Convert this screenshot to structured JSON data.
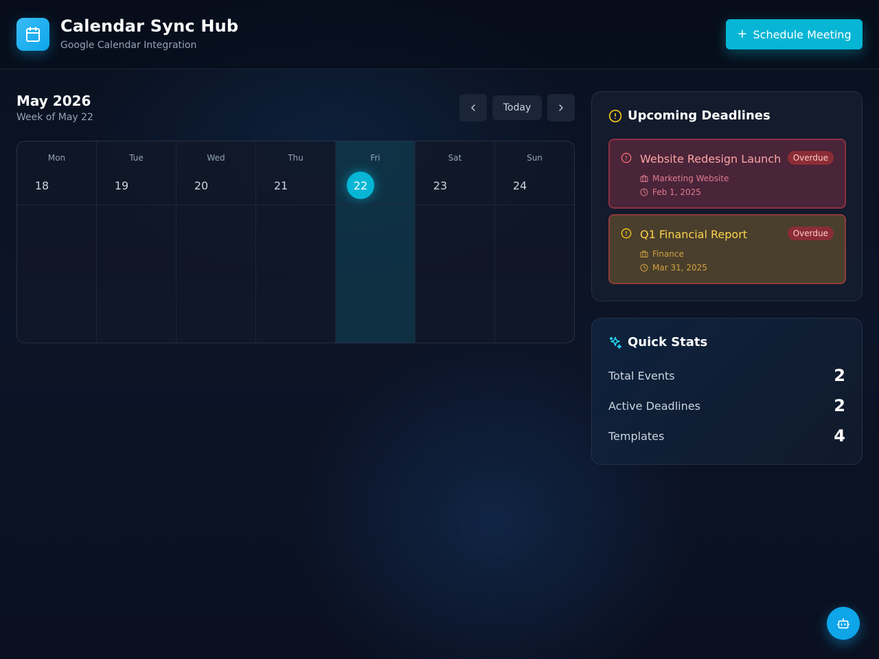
{
  "header": {
    "app_icon": "calendar-icon",
    "title": "Calendar Sync Hub",
    "subtitle": "Google Calendar Integration",
    "schedule_button": {
      "icon": "plus-icon",
      "label": "Schedule Meeting"
    }
  },
  "calendar": {
    "month": "May 2026",
    "week_label": "Week of May 22",
    "today_button": "Today",
    "prev_icon": "chevron-left-icon",
    "next_icon": "chevron-right-icon",
    "days": [
      {
        "name": "Mon",
        "num": "18"
      },
      {
        "name": "Tue",
        "num": "19"
      },
      {
        "name": "Wed",
        "num": "20"
      },
      {
        "name": "Thu",
        "num": "21"
      },
      {
        "name": "Fri",
        "num": "22"
      },
      {
        "name": "Sat",
        "num": "23"
      },
      {
        "name": "Sun",
        "num": "24"
      }
    ],
    "selected_day": "22"
  },
  "deadlines": {
    "title": "Upcoming Deadlines",
    "icon": "alert-circle-icon",
    "items": [
      {
        "title": "Website Redesign Launch",
        "badge": "Overdue",
        "project": "Marketing Website",
        "date": "Feb 1, 2025"
      },
      {
        "title": "Q1 Financial Report",
        "badge": "Overdue",
        "project": "Finance",
        "date": "Mar 31, 2025"
      }
    ]
  },
  "stats": {
    "title": "Quick Stats",
    "icon": "sparkles-icon",
    "rows": [
      {
        "label": "Total Events",
        "value": "2"
      },
      {
        "label": "Active Deadlines",
        "value": "2"
      },
      {
        "label": "Templates",
        "value": "4"
      }
    ]
  },
  "fab": {
    "icon": "bot-icon"
  },
  "colors": {
    "accent": "#06b6d4",
    "overdue": "#8b2d35",
    "warning": "#fcd34d"
  }
}
